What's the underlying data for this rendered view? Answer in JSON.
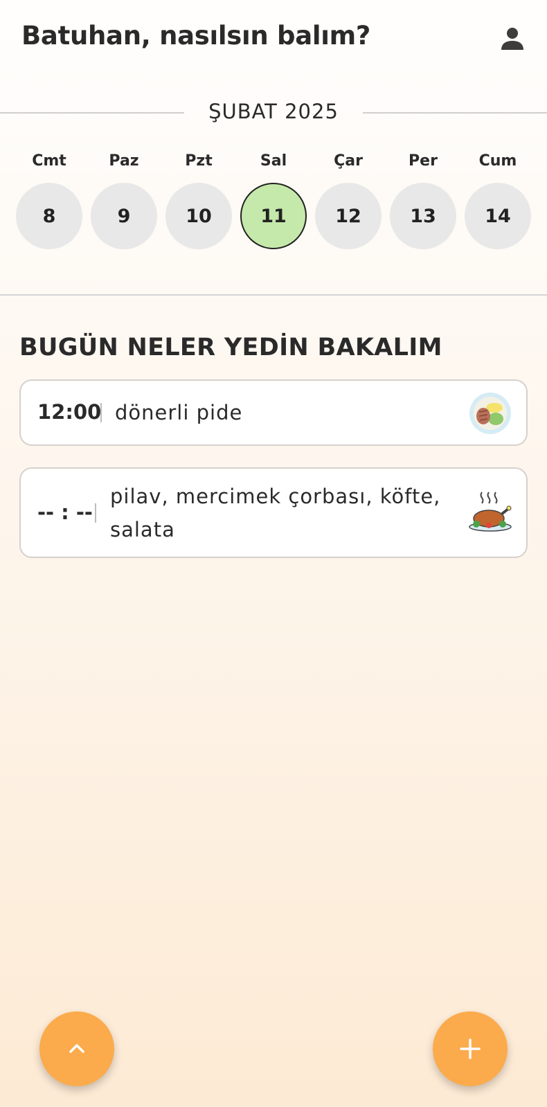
{
  "header": {
    "greeting": "Batuhan, nasılsın balım?",
    "profile_icon": "person-icon"
  },
  "calendar": {
    "month_label": "ŞUBAT 2025",
    "days": [
      {
        "name": "Cmt",
        "number": "8",
        "selected": false
      },
      {
        "name": "Paz",
        "number": "9",
        "selected": false
      },
      {
        "name": "Pzt",
        "number": "10",
        "selected": false
      },
      {
        "name": "Sal",
        "number": "11",
        "selected": true
      },
      {
        "name": "Çar",
        "number": "12",
        "selected": false
      },
      {
        "name": "Per",
        "number": "13",
        "selected": false
      },
      {
        "name": "Cum",
        "number": "14",
        "selected": false
      }
    ],
    "selected_color": "#c5e9aa",
    "day_color": "#e8e8e8"
  },
  "meals_section": {
    "title": "BUGÜN NELER YEDİN BAKALIM",
    "entries": [
      {
        "time": "12:00",
        "description": "dönerli pide",
        "icon": "doner-plate-icon"
      },
      {
        "time": "-- : --",
        "description": "pilav, mercimek çorbası, köfte, salata",
        "icon": "roast-chicken-icon"
      }
    ]
  },
  "actions": {
    "scroll_up_icon": "chevron-up-icon",
    "add_icon": "plus-icon",
    "accent_color": "#fbab4c"
  }
}
